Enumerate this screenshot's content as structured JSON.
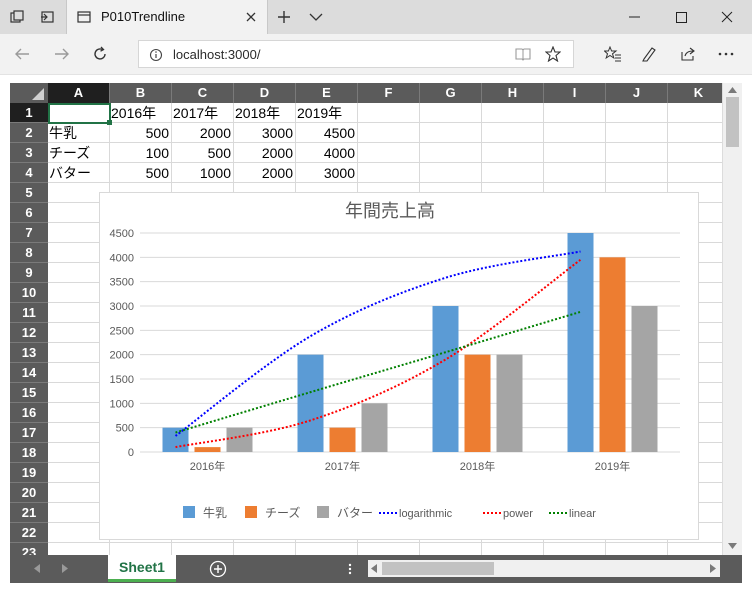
{
  "browser": {
    "tab_title": "P010Trendline",
    "url": "localhost:3000/"
  },
  "spreadsheet": {
    "columns": [
      "A",
      "B",
      "C",
      "D",
      "E",
      "F",
      "G",
      "H",
      "I",
      "J",
      "K"
    ],
    "rows": [
      "1",
      "2",
      "3",
      "4",
      "5",
      "6",
      "7",
      "8",
      "9",
      "10",
      "11",
      "12",
      "13",
      "14",
      "15",
      "16",
      "17",
      "18",
      "19",
      "20",
      "21",
      "22",
      "23"
    ],
    "selected_cell": "A1",
    "cells": {
      "B1": "2016年",
      "C1": "2017年",
      "D1": "2018年",
      "E1": "2019年",
      "A2": "牛乳",
      "B2": "500",
      "C2": "2000",
      "D2": "3000",
      "E2": "4500",
      "A3": "チーズ",
      "B3": "100",
      "C3": "500",
      "D3": "2000",
      "E3": "4000",
      "A4": "バター",
      "B4": "500",
      "C4": "1000",
      "D4": "2000",
      "E4": "3000"
    },
    "sheet_tab": "Sheet1"
  },
  "chart_data": {
    "type": "bar",
    "title": "年間売上高",
    "categories": [
      "2016年",
      "2017年",
      "2018年",
      "2019年"
    ],
    "series": [
      {
        "name": "牛乳",
        "values": [
          500,
          2000,
          3000,
          4500
        ],
        "color": "#5b9bd5"
      },
      {
        "name": "チーズ",
        "values": [
          100,
          500,
          2000,
          4000
        ],
        "color": "#ed7d31"
      },
      {
        "name": "バター",
        "values": [
          500,
          1000,
          2000,
          3000
        ],
        "color": "#a5a5a5"
      }
    ],
    "trendlines": [
      {
        "name": "logarithmic",
        "color": "#0000ff",
        "values": [
          330,
          2380,
          3580,
          4120
        ]
      },
      {
        "name": "power",
        "color": "#ff0000",
        "values": [
          100,
          650,
          1900,
          3950
        ]
      },
      {
        "name": "linear",
        "color": "#008000",
        "values": [
          400,
          1230,
          2050,
          2880
        ]
      }
    ],
    "ylim": [
      0,
      4500
    ],
    "yticks": [
      0,
      500,
      1000,
      1500,
      2000,
      2500,
      3000,
      3500,
      4000,
      4500
    ],
    "grid": true,
    "legend": "bottom"
  }
}
